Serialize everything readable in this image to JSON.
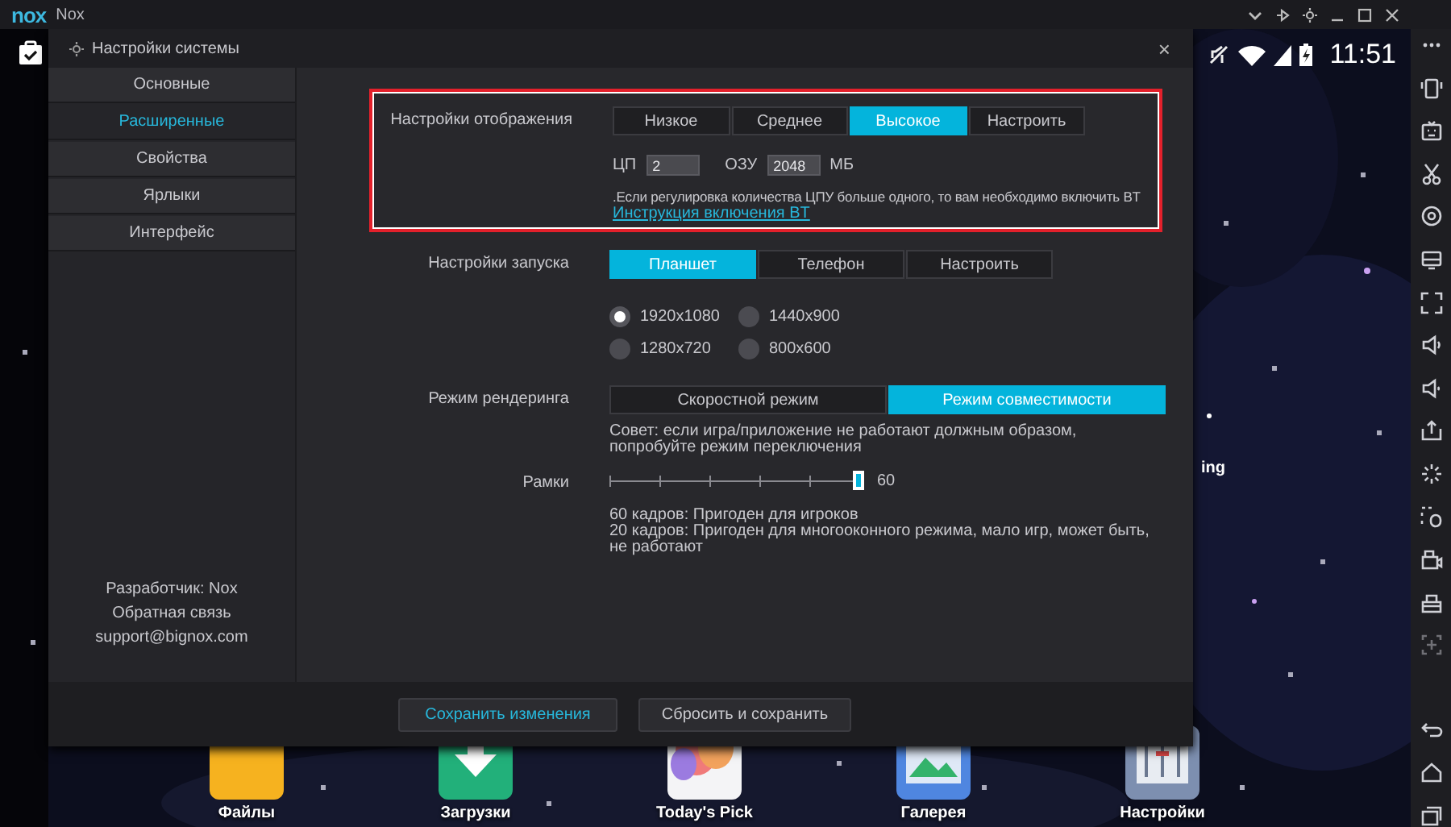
{
  "titlebar": {
    "logo": "nox",
    "title": "Nox"
  },
  "dialog": {
    "title": "Настройки системы",
    "close": "×"
  },
  "sidebar": {
    "items": [
      {
        "label": "Основные",
        "selected": false
      },
      {
        "label": "Расширенные",
        "selected": true
      },
      {
        "label": "Свойства",
        "selected": false
      },
      {
        "label": "Ярлыки",
        "selected": false
      },
      {
        "label": "Интерфейс",
        "selected": false
      }
    ],
    "footer": [
      "Разработчик: Nox",
      "Обратная связь",
      "support@bignox.com"
    ]
  },
  "display": {
    "label": "Настройки отображения",
    "highlighted": true,
    "options": [
      {
        "label": "Низкое",
        "selected": false
      },
      {
        "label": "Среднее",
        "selected": false
      },
      {
        "label": "Высокое",
        "selected": true
      },
      {
        "label": "Настроить",
        "selected": false
      }
    ],
    "cpu_label": "ЦП",
    "cpu": "2",
    "ram_label": "ОЗУ",
    "ram": "2048",
    "ram_unit": "МБ",
    "note": ".Если регулировка количества ЦПУ больше одного, то вам необходимо включить BT",
    "link": "Инструкция включения BT"
  },
  "startup": {
    "label": "Настройки запуска",
    "options": [
      {
        "label": "Планшет",
        "selected": true
      },
      {
        "label": "Телефон",
        "selected": false
      },
      {
        "label": "Настроить",
        "selected": false
      }
    ],
    "resolutions": [
      {
        "label": "1920x1080",
        "selected": true
      },
      {
        "label": "1440x900",
        "selected": false
      },
      {
        "label": "1280x720",
        "selected": false
      },
      {
        "label": "800x600",
        "selected": false
      }
    ]
  },
  "render": {
    "label": "Режим рендеринга",
    "options": [
      {
        "label": "Скоростной режим",
        "selected": false
      },
      {
        "label": "Режим совместимости",
        "selected": true
      }
    ],
    "tip": "Совет: если игра/приложение не работают должным образом, попробуйте режим переключения"
  },
  "frames": {
    "label": "Рамки",
    "level": 1,
    "reading": "60",
    "notes": [
      "60 кадров: Пригоден для игроков",
      "20 кадров: Пригоден для многооконного режима, мало игр, может быть, не работают"
    ]
  },
  "buttons": [
    {
      "label": "Сохранить изменения",
      "kind": "primary"
    },
    {
      "label": "Сбросить и сохранить",
      "kind": "secondary"
    }
  ],
  "status_bar": {
    "time": "11:51"
  },
  "background_label": "ing",
  "dock": [
    {
      "label": "Файлы",
      "kind": "files"
    },
    {
      "label": "Загрузки",
      "kind": "downloads"
    },
    {
      "label": "Today's Pick",
      "kind": "pick"
    },
    {
      "label": "Галерея",
      "kind": "gallery"
    },
    {
      "label": "Настройки",
      "kind": "settings"
    }
  ]
}
